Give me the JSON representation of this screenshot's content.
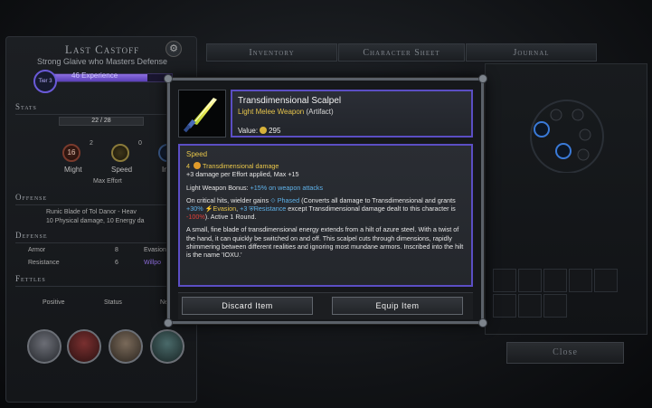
{
  "character": {
    "name": "Last Castoff",
    "subtitle": "Strong Glaive who Masters Defense",
    "tier": "Tier 3",
    "xp": "46 Experience",
    "tier_progress": 0.82
  },
  "tabs": {
    "inventory": "Inventory",
    "character_sheet": "Character Sheet",
    "journal": "Journal"
  },
  "stats": {
    "heading": "Stats",
    "pool": "22 / 28",
    "might_val": "16",
    "might_edge": "2",
    "speed_edge": "0",
    "might_label": "Might",
    "speed_label": "Speed",
    "intellect_label": "Int",
    "max_effort": "Max Effort"
  },
  "offense": {
    "heading": "Offense",
    "weapon": "Runic Blade of Tol Danor - Heav",
    "damage": "10 Physical damage, 10 Energy da"
  },
  "defense": {
    "heading": "Defense",
    "armor_label": "Armor",
    "armor_val": "8",
    "evasion_label": "Evasion",
    "resistance_label": "Resistance",
    "resistance_val": "6",
    "willpower_label": "Willpo"
  },
  "fetters": {
    "heading": "Fettles",
    "positive": "Positive",
    "status": "Status",
    "neg": "Ne"
  },
  "close": "Close",
  "item": {
    "name": "Transdimensional Scalpel",
    "type": "Light Melee Weapon",
    "rarity": "(Artifact)",
    "value_label": "Value:",
    "value": "295",
    "speed_heading": "Speed",
    "damage_num": "4",
    "damage_type": "Transdimensional damage",
    "effort_line": "+3 damage per Effort applied, Max +15",
    "bonus_prefix": "Light Weapon Bonus:",
    "bonus_value": "+15% on weapon attacks",
    "crit_1": "On critical hits, wielder gains",
    "phased": "Phased",
    "crit_2": "(Converts all damage to Transdimensional and grants",
    "evasion_pct": "+30%",
    "evasion_word": "Evasion",
    "crit_3": ",",
    "resist_num": "+3",
    "resist_word": "Resistance",
    "crit_4": "except Transdimensional damage dealt to this character is",
    "minus_pct": "-100%",
    "crit_5": "). Active 1 Round.",
    "lore": "A small, fine blade of transdimensional energy extends from a hilt of azure steel. With a twist of the hand, it can quickly be switched on and off. This scalpel cuts through dimensions, rapidly shimmering between different realities and ignoring most mundane armors. Inscribed into the hilt is the name 'IOXU.'"
  },
  "buttons": {
    "discard": "Discard Item",
    "equip": "Equip Item"
  },
  "colors": {
    "frame_accent": "#5b4ec4",
    "gold": "#e8c64a",
    "keyword_blue": "#5fb3ea",
    "negative_red": "#e2413a"
  },
  "icons": {
    "item": "scalpel-blade-icon",
    "coin": "shins-coin-icon",
    "gear": "gear-icon"
  }
}
